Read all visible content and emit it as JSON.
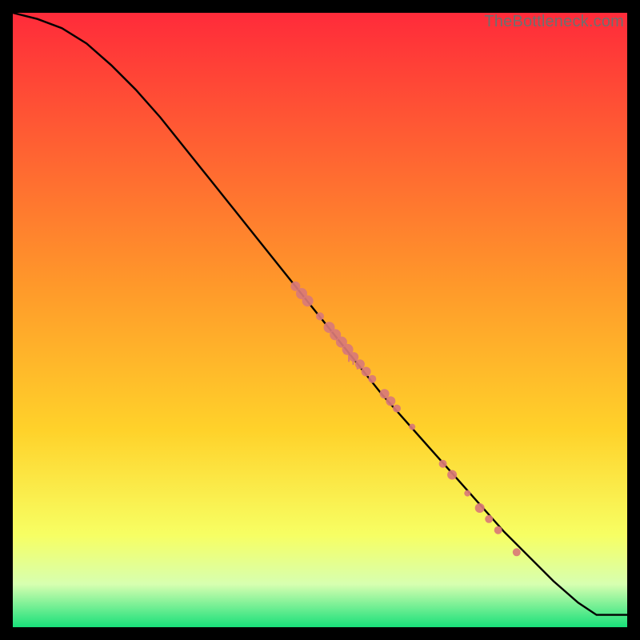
{
  "watermark": "TheBottleneck.com",
  "colors": {
    "gradient_top": "#ff2b3a",
    "gradient_mid1": "#ff7a2a",
    "gradient_mid2": "#ffd22a",
    "gradient_mid3": "#f7ff63",
    "gradient_mid4": "#d7ffb0",
    "gradient_bottom": "#18e07a",
    "curve": "#000000",
    "marker": "#d97a77"
  },
  "chart_data": {
    "type": "line",
    "title": "",
    "xlabel": "",
    "ylabel": "",
    "xlim": [
      0,
      100
    ],
    "ylim": [
      0,
      100
    ],
    "series": [
      {
        "name": "curve",
        "x": [
          0,
          4,
          8,
          12,
          16,
          20,
          24,
          28,
          32,
          36,
          40,
          44,
          48,
          52,
          56,
          60,
          64,
          68,
          72,
          76,
          80,
          84,
          88,
          92,
          95,
          100
        ],
        "y": [
          100,
          99,
          97.5,
          95,
          91.5,
          87.5,
          83,
          78,
          73,
          68,
          63,
          58,
          53,
          48,
          43,
          38,
          33.5,
          29,
          24.5,
          20,
          15.5,
          11.5,
          7.5,
          4,
          2,
          2
        ]
      }
    ],
    "markers": [
      {
        "x": 46.0,
        "y": 55.5,
        "r": 6
      },
      {
        "x": 47.0,
        "y": 54.3,
        "r": 7
      },
      {
        "x": 48.0,
        "y": 53.1,
        "r": 7
      },
      {
        "x": 50.0,
        "y": 50.6,
        "r": 5
      },
      {
        "x": 51.5,
        "y": 48.8,
        "r": 7
      },
      {
        "x": 52.5,
        "y": 47.6,
        "r": 7
      },
      {
        "x": 53.5,
        "y": 46.4,
        "r": 7
      },
      {
        "x": 54.5,
        "y": 45.2,
        "r": 7
      },
      {
        "x": 55.5,
        "y": 44.0,
        "r": 6
      },
      {
        "x": 56.5,
        "y": 42.8,
        "r": 6
      },
      {
        "x": 57.5,
        "y": 41.6,
        "r": 6
      },
      {
        "x": 58.5,
        "y": 40.4,
        "r": 5
      },
      {
        "x": 60.5,
        "y": 38.0,
        "r": 6
      },
      {
        "x": 61.5,
        "y": 36.8,
        "r": 6
      },
      {
        "x": 62.5,
        "y": 35.6,
        "r": 5
      },
      {
        "x": 65.0,
        "y": 32.6,
        "r": 4
      },
      {
        "x": 70.0,
        "y": 26.6,
        "r": 5
      },
      {
        "x": 71.5,
        "y": 24.8,
        "r": 6
      },
      {
        "x": 74.0,
        "y": 21.8,
        "r": 4
      },
      {
        "x": 76.0,
        "y": 19.4,
        "r": 6
      },
      {
        "x": 77.5,
        "y": 17.6,
        "r": 5
      },
      {
        "x": 79.0,
        "y": 15.8,
        "r": 5
      },
      {
        "x": 82.0,
        "y": 12.2,
        "r": 5
      }
    ],
    "comb_ticks": [
      {
        "x": 54.0,
        "len": 6
      },
      {
        "x": 54.7,
        "len": 9
      },
      {
        "x": 55.4,
        "len": 6
      },
      {
        "x": 56.1,
        "len": 5
      }
    ]
  }
}
